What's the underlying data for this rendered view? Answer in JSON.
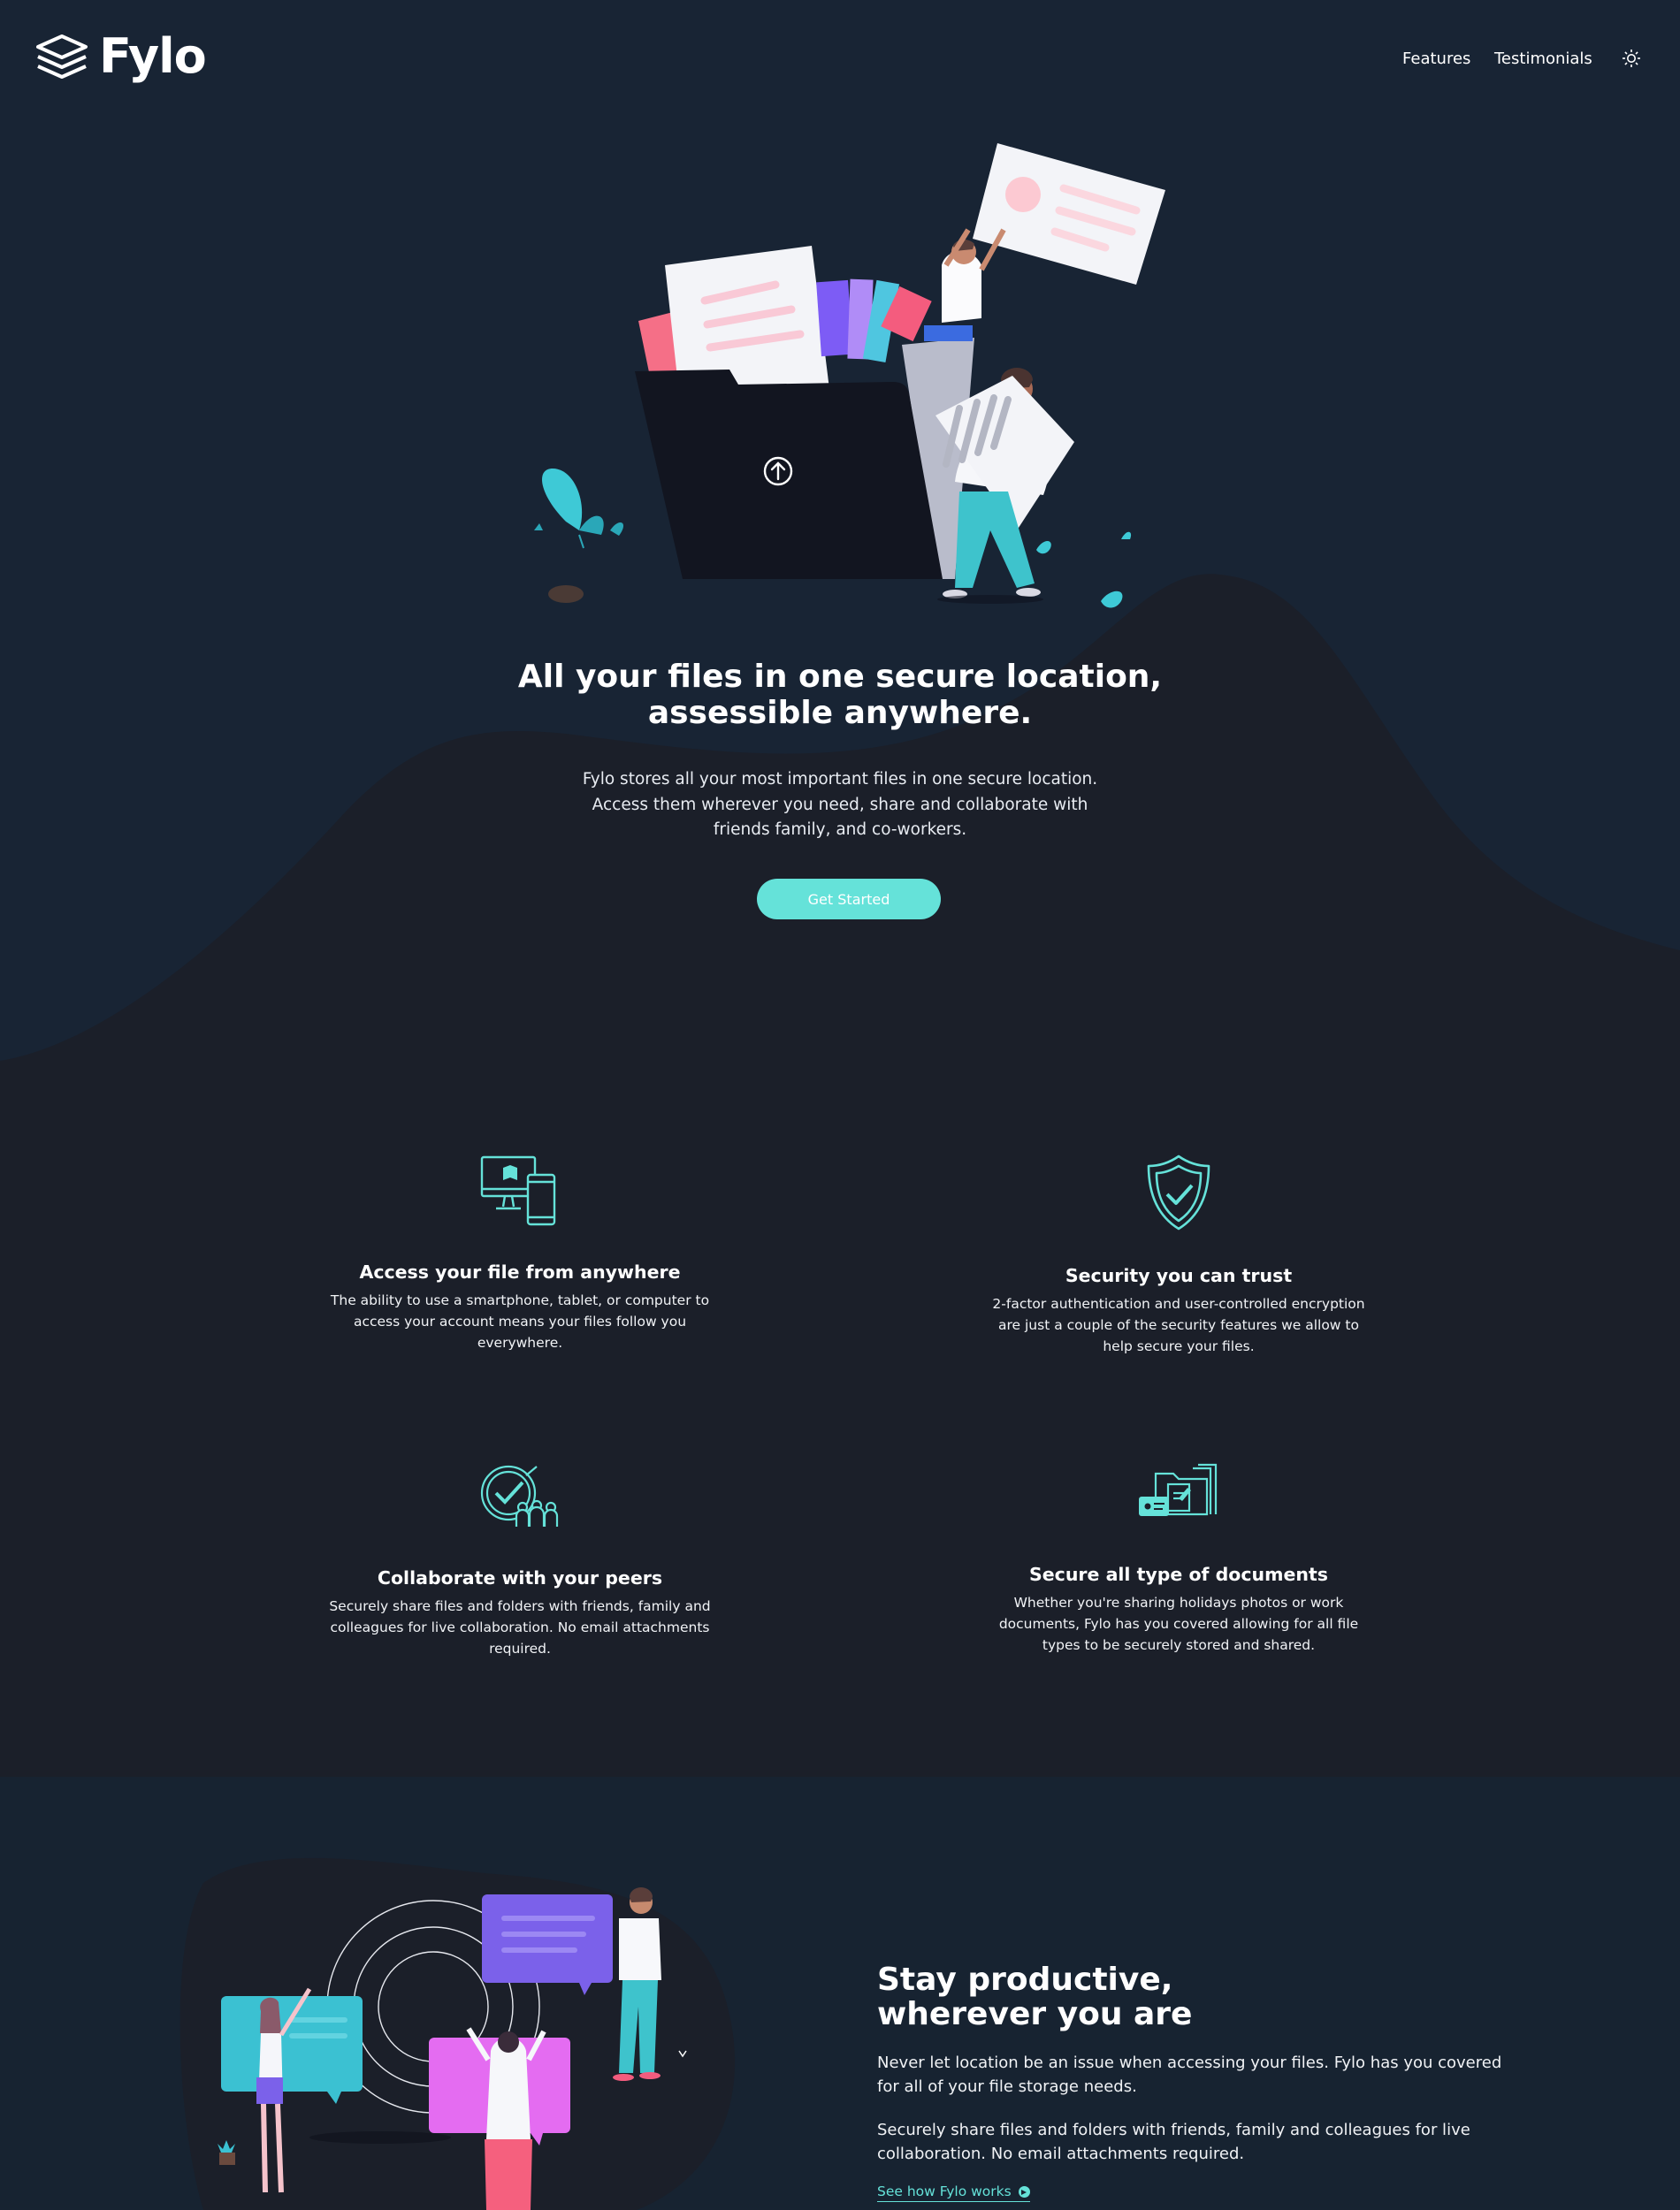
{
  "brand": {
    "name": "Fylo",
    "logo_icon": "stacked-layers-icon"
  },
  "nav": {
    "items": [
      {
        "label": "Features"
      },
      {
        "label": "Testimonials"
      }
    ],
    "theme_toggle_icon": "sun-icon"
  },
  "hero": {
    "title_line1": "All your files in one secure location,",
    "title_line2": "assessible anywhere.",
    "subtitle": "Fylo stores all your most important files in one secure location. Access them wherever you need, share and collaborate with friends family, and co-workers.",
    "cta_label": "Get Started",
    "illustration_icon": "upload-arrow-icon"
  },
  "features": [
    {
      "icon": "devices-icon",
      "title": "Access your file from anywhere",
      "text": "The ability to use a smartphone, tablet, or computer to access your account means your files follow you everywhere."
    },
    {
      "icon": "shield-check-icon",
      "title": "Security you can trust",
      "text": "2-factor authentication and user-controlled encryption are just a couple of the security features we allow to help secure your files."
    },
    {
      "icon": "collaborate-icon",
      "title": "Collaborate with your peers",
      "text": "Securely share files and folders with friends, family and colleagues for live collaboration. No email attachments required."
    },
    {
      "icon": "documents-folder-icon",
      "title": "Secure all type of documents",
      "text": "Whether you're sharing holidays photos or work documents, Fylo has you covered allowing for all file types to be securely stored and shared."
    }
  ],
  "productive": {
    "title_line1": "Stay productive,",
    "title_line2": "wherever you are",
    "paragraph1": "Never let location be an issue when accessing your files. Fylo has you covered for all of your file storage needs.",
    "paragraph2": "Securely share files and folders with friends, family and colleagues for live collaboration. No email attachments required.",
    "link_label": "See how Fylo works"
  },
  "colors": {
    "hero_bg": "#182434",
    "body_bg": "#1b1f29",
    "accent": "#65e2d9",
    "text": "#ffffff"
  }
}
